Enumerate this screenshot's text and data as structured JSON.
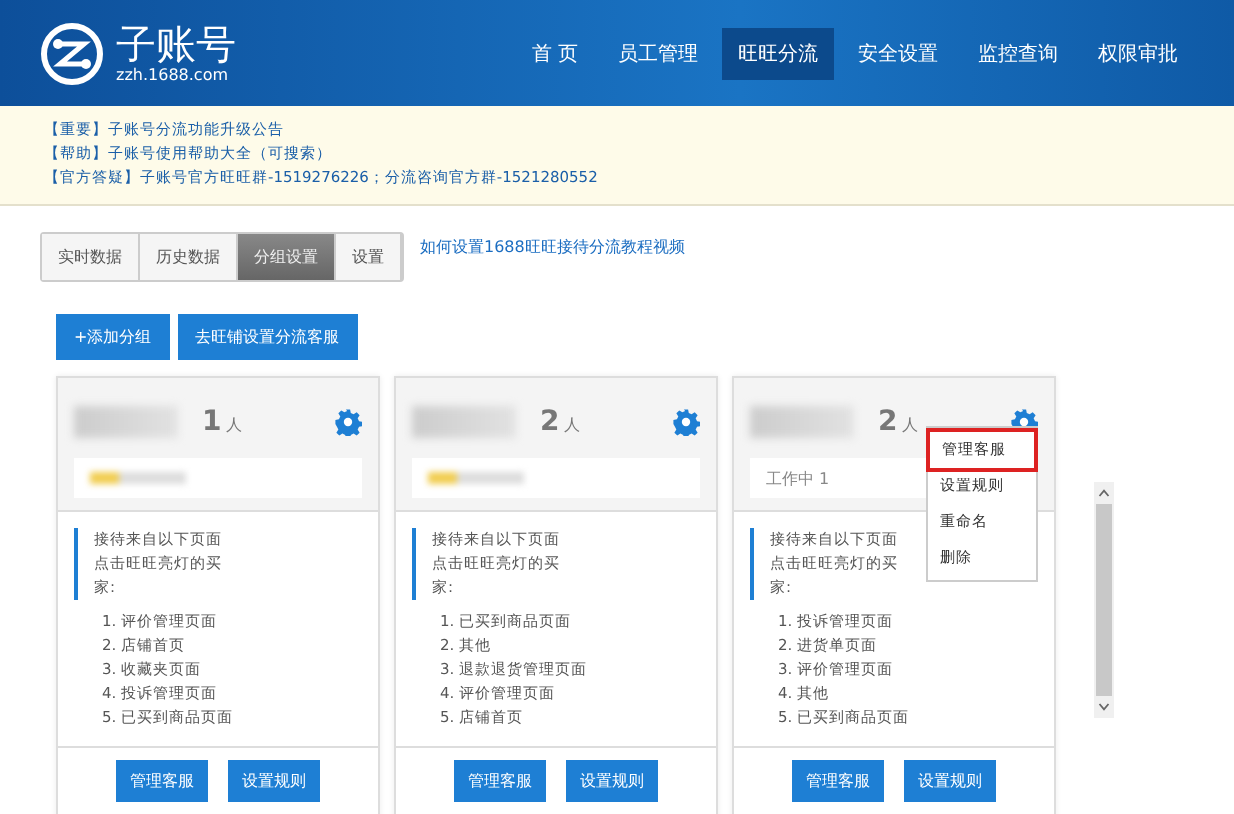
{
  "header": {
    "logo_title": "子账号",
    "logo_domain": "zzh.1688.com",
    "nav": [
      {
        "label": "首 页",
        "selected": false
      },
      {
        "label": "员工管理",
        "selected": false
      },
      {
        "label": "旺旺分流",
        "selected": true
      },
      {
        "label": "安全设置",
        "selected": false
      },
      {
        "label": "监控查询",
        "selected": false
      },
      {
        "label": "权限审批",
        "selected": false
      }
    ]
  },
  "notices": [
    {
      "tag": "【重要】",
      "text": "子账号分流功能升级公告"
    },
    {
      "tag": "【帮助】",
      "text": "子账号使用帮助大全（可搜索）"
    },
    {
      "tag": "【官方答疑】",
      "text": "子账号官方旺旺群-1519276226；分流咨询官方群-1521280552"
    }
  ],
  "tabs": [
    {
      "label": "实时数据",
      "selected": false
    },
    {
      "label": "历史数据",
      "selected": false
    },
    {
      "label": "分组设置",
      "selected": true
    },
    {
      "label": "设置",
      "selected": false
    }
  ],
  "tutorial_link": "如何设置1688旺旺接待分流教程视频",
  "actions": [
    "+添加分组",
    "去旺铺设置分流客服"
  ],
  "groups": [
    {
      "count": "1",
      "unit": "人",
      "intro": "接待来自以下页面点击旺旺亮灯的买家:",
      "pages": [
        "1. 评价管理页面",
        "2. 店铺首页",
        "3. 收藏夹页面",
        "4. 投诉管理页面",
        "5. 已买到商品页面"
      ],
      "buttons": [
        "管理客服",
        "设置规则"
      ]
    },
    {
      "count": "2",
      "unit": "人",
      "intro": "接待来自以下页面点击旺旺亮灯的买家:",
      "pages": [
        "1. 已买到商品页面",
        "2. 其他",
        "3. 退款退货管理页面",
        "4. 评价管理页面",
        "5. 店铺首页"
      ],
      "buttons": [
        "管理客服",
        "设置规则"
      ]
    },
    {
      "count": "2",
      "unit": "人",
      "status": "工作中 1",
      "intro": "接待来自以下页面点击旺旺亮灯的买家:",
      "pages": [
        "1. 投诉管理页面",
        "2. 进货单页面",
        "3. 评价管理页面",
        "4. 其他",
        "5. 已买到商品页面"
      ],
      "buttons": [
        "管理客服",
        "设置规则"
      ]
    }
  ],
  "menu": {
    "items": [
      {
        "label": "管理客服",
        "selected": true
      },
      {
        "label": "设置规则",
        "selected": false
      },
      {
        "label": "重命名",
        "selected": false
      },
      {
        "label": "删除",
        "selected": false
      }
    ]
  }
}
